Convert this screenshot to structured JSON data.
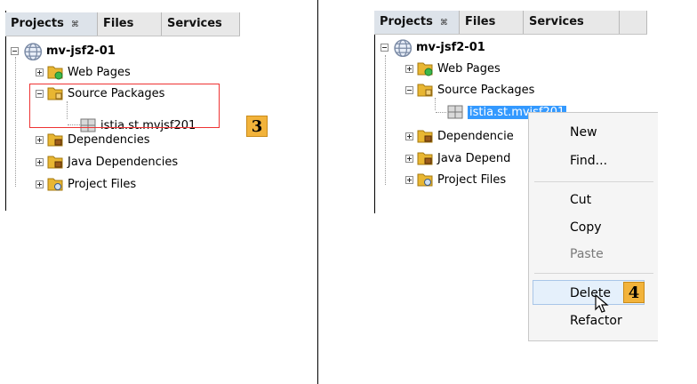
{
  "tabs": [
    "Projects",
    "Files",
    "Services"
  ],
  "tab_close_glyph": "⌘",
  "project": "mv-jsf2-01",
  "tree_items": [
    "Web Pages",
    "Source Packages",
    "istia.st.mvjsf201",
    "Dependencies",
    "Java Dependencies",
    "Project Files"
  ],
  "right_tree_items": [
    "Web Pages",
    "Source Packages",
    "istia.st.mvjsf201",
    "Dependencie",
    "Java Depend",
    "Project Files"
  ],
  "context_menu": [
    "New",
    "Find...",
    "Cut",
    "Copy",
    "Paste",
    "Delete",
    "Refactor"
  ],
  "badges": [
    "3",
    "4"
  ],
  "colors": {
    "highlight_border": "#ee3333",
    "badge_fill": "#f2b33b",
    "selection": "#3399ff"
  }
}
